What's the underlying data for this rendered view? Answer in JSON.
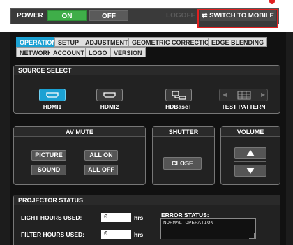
{
  "header": {
    "power_label": "POWER",
    "on_label": "ON",
    "off_label": "OFF",
    "logoff_label": "LOGOFF",
    "switch_mobile_label": "SWITCH TO MOBILE",
    "switch_icon": "sync-icon"
  },
  "tabs": {
    "row1": [
      "OPERATION",
      "SETUP",
      "ADJUSTMENT",
      "GEOMETRIC CORRECTION",
      "EDGE BLENDING"
    ],
    "row2": [
      "NETWORK",
      "ACCOUNT",
      "LOGO",
      "VERSION"
    ],
    "active": "OPERATION"
  },
  "source_select": {
    "title": "SOURCE SELECT",
    "sources": [
      "HDMI1",
      "HDMI2",
      "HDBaseT",
      "TEST PATTERN"
    ],
    "selected": "HDMI1"
  },
  "av_mute": {
    "title": "AV MUTE",
    "picture_label": "PICTURE",
    "all_on_label": "ALL ON",
    "sound_label": "SOUND",
    "all_off_label": "ALL OFF"
  },
  "shutter": {
    "title": "SHUTTER",
    "close_label": "CLOSE"
  },
  "volume": {
    "title": "VOLUME",
    "up_icon": "triangle-up-icon",
    "down_icon": "triangle-down-icon"
  },
  "projector_status": {
    "title": "PROJECTOR STATUS",
    "light_hours_label": "LIGHT HOURS USED:",
    "light_hours_value": "0",
    "filter_hours_label": "FILTER HOURS USED:",
    "filter_hours_value": "0",
    "hrs_unit": "hrs",
    "error_status_label": "ERROR STATUS:",
    "error_status_value": "NORMAL OPERATION"
  },
  "colors": {
    "accent": "#1ba1d3",
    "on_green": "#3fae49",
    "highlight_red": "#e02020"
  }
}
